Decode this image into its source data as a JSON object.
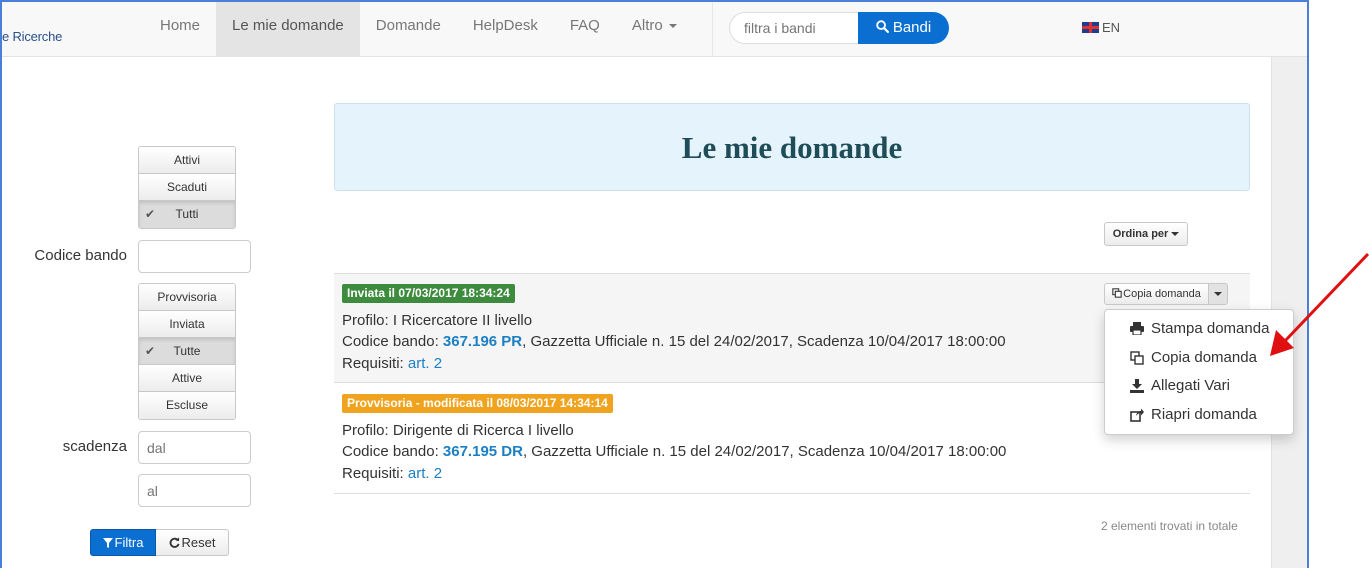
{
  "brand": "e Ricerche",
  "nav": {
    "items": [
      {
        "label": "Home"
      },
      {
        "label": "Le mie domande"
      },
      {
        "label": "Domande"
      },
      {
        "label": "HelpDesk"
      },
      {
        "label": "FAQ"
      },
      {
        "label": "Altro"
      }
    ],
    "search_placeholder": "filtra i bandi",
    "search_button": "Bandi",
    "lang": "EN"
  },
  "filters": {
    "status_group": [
      "Attivi",
      "Scaduti",
      "Tutti"
    ],
    "codice_label": "Codice bando",
    "state_group": [
      "Provvisoria",
      "Inviata",
      "Tutte",
      "Attive",
      "Escluse"
    ],
    "scadenza_label": "scadenza",
    "dal_placeholder": "dal",
    "al_placeholder": "al",
    "filtra": "Filtra",
    "reset": "Reset"
  },
  "main": {
    "title": "Le mie domande",
    "sort_label": "Ordina per",
    "applications": [
      {
        "badge": "Inviata il 07/03/2017 18:34:24",
        "profilo_prefix": "Profilo: ",
        "profilo": "I Ricercatore II livello",
        "codice_prefix": "Codice bando: ",
        "codice": "367.196 PR",
        "codice_suffix": ", Gazzetta Ufficiale n. 15 del 24/02/2017, Scadenza 10/04/2017 18:00:00",
        "requisiti_prefix": "Requisiti: ",
        "requisiti": "art. 2",
        "action": "Copia domanda"
      },
      {
        "badge": "Provvisoria - modificata il 08/03/2017 14:34:14",
        "profilo_prefix": "Profilo: ",
        "profilo": "Dirigente di Ricerca I livello",
        "codice_prefix": "Codice bando: ",
        "codice": "367.195 DR",
        "codice_suffix": ", Gazzetta Ufficiale n. 15 del 24/02/2017, Scadenza 10/04/2017 18:00:00",
        "requisiti_prefix": "Requisiti: ",
        "requisiti": "art. 2"
      }
    ],
    "dropdown": [
      "Stampa domanda",
      "Copia domanda",
      "Allegati Vari",
      "Riapri domanda"
    ],
    "total": "2 elementi trovati in totale"
  },
  "colors": {
    "primary": "#0a6fd1",
    "badge_sent": "#3d8b3d",
    "badge_draft": "#f0a31e",
    "annotation_arrow": "#e01010"
  }
}
